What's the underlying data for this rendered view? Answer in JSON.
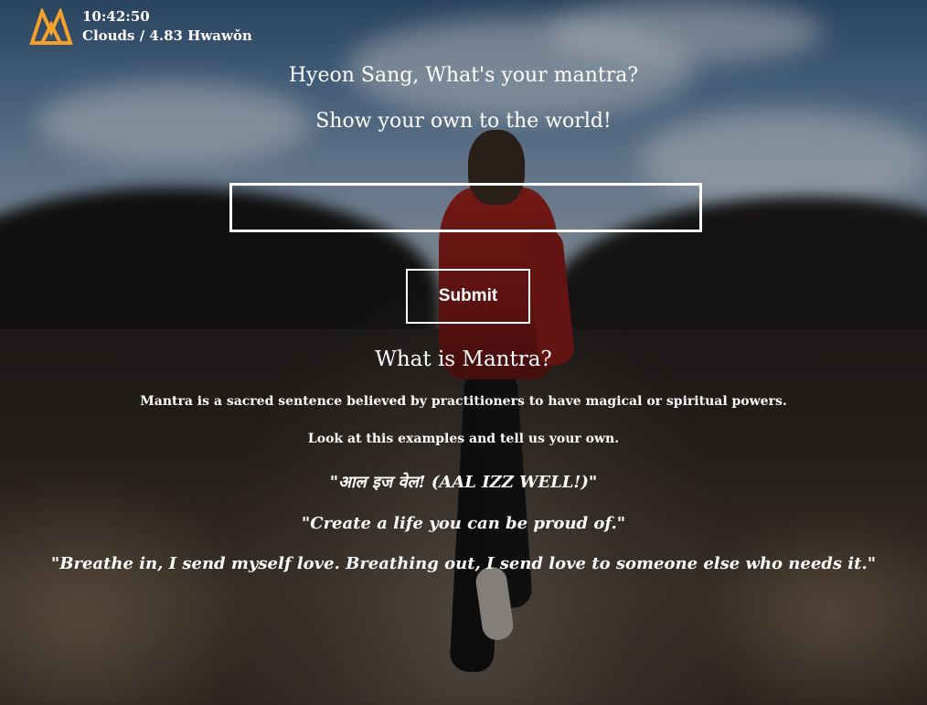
{
  "header": {
    "time": "10:42:50",
    "weather": "Clouds / 4.83 Hwawǒn"
  },
  "colors": {
    "logo_accent": "#f4a12b",
    "text": "#ffffff"
  },
  "main": {
    "greeting": "Hyeon Sang, What's your mantra?",
    "subtitle": "Show your own to the world!",
    "mantra_input": {
      "value": "",
      "placeholder": ""
    },
    "submit_label": "Submit"
  },
  "about": {
    "title": "What is Mantra?",
    "description": "Mantra is a sacred sentence believed by practitioners to have magical or spiritual powers.",
    "prompt": "Look at this examples and tell us your own.",
    "examples": [
      "\"आल इज वेल! (AAL IZZ WELL!)\"",
      "\"Create a life you can be proud of.\"",
      "\"Breathe in, I send myself love. Breathing out, I send love to someone else who needs it.\""
    ]
  },
  "icons": {
    "logo": "mountain-logo-icon"
  }
}
